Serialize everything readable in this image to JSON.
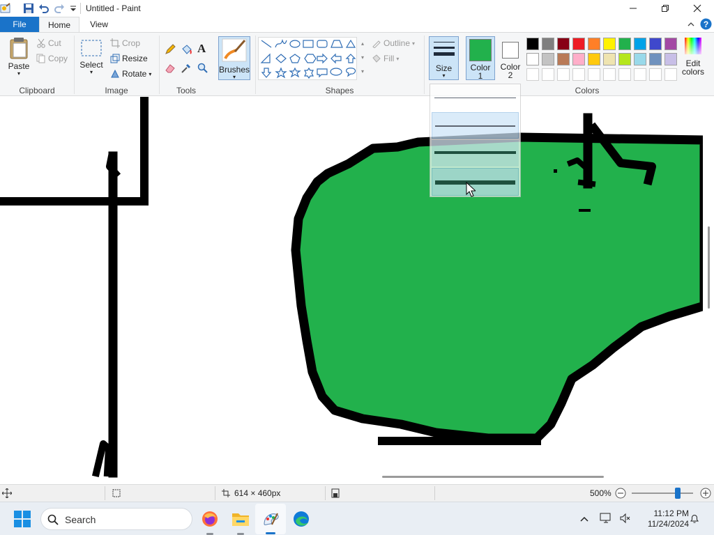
{
  "window": {
    "title": "Untitled - Paint",
    "controls": [
      "minimize",
      "restore",
      "close"
    ]
  },
  "quick_access": [
    "paint-app-icon",
    "save-icon",
    "undo-icon",
    "redo-icon",
    "customize-dropdown-icon"
  ],
  "menu": {
    "file": "File",
    "home": "Home",
    "view": "View"
  },
  "ribbon": {
    "clipboard": {
      "group": "Clipboard",
      "paste": "Paste",
      "cut": "Cut",
      "copy": "Copy"
    },
    "image": {
      "group": "Image",
      "select": "Select",
      "crop": "Crop",
      "resize": "Resize",
      "rotate": "Rotate"
    },
    "tools": {
      "group": "Tools",
      "text_glyph": "A"
    },
    "brushes": {
      "label": "Brushes"
    },
    "shapes": {
      "group": "Shapes",
      "outline": "Outline",
      "fill": "Fill"
    },
    "size": {
      "label": "Size"
    },
    "color1": {
      "label1": "Color",
      "label2": "1",
      "value": "#22b14c"
    },
    "color2": {
      "label1": "Color",
      "label2": "2",
      "value": "#ffffff"
    },
    "colors": {
      "group": "Colors",
      "edit_label1": "Edit",
      "edit_label2": "colors"
    },
    "palette_row1": [
      "#000000",
      "#7f7f7f",
      "#880015",
      "#ed1c24",
      "#ff7f27",
      "#fff200",
      "#22b14c",
      "#00a2e8",
      "#3f48cc",
      "#a349a4"
    ],
    "palette_row2": [
      "#ffffff",
      "#c3c3c3",
      "#b97a57",
      "#ffaec9",
      "#ffc90e",
      "#efe4b0",
      "#b5e61d",
      "#99d9ea",
      "#7092be",
      "#c8bfe7"
    ],
    "palette_row3": [
      "#ffffff",
      "#ffffff",
      "#ffffff",
      "#ffffff",
      "#ffffff",
      "#ffffff",
      "#ffffff",
      "#ffffff",
      "#ffffff",
      "#ffffff"
    ]
  },
  "size_dropdown": {
    "options": [
      "1px",
      "3px",
      "5px",
      "8px"
    ],
    "selected_index": 3,
    "hover_index": 1
  },
  "canvas": {
    "fill_color": "#22b14c",
    "stroke_color": "#000000"
  },
  "status": {
    "dimensions": "614 × 460px",
    "zoom": "500%",
    "zoom_slider_fraction": 0.75
  },
  "taskbar": {
    "search_placeholder": "Search",
    "time": "11:12 PM",
    "date": "11/24/2024",
    "apps": [
      "start-icon",
      "firefox-icon",
      "file-explorer-icon",
      "paint-icon",
      "edge-icon"
    ]
  }
}
